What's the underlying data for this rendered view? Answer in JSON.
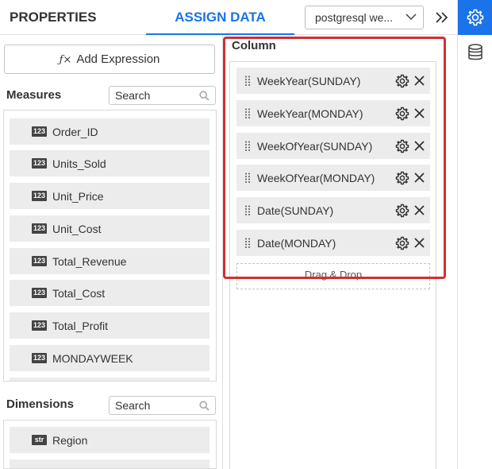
{
  "tabs": {
    "properties": "PROPERTIES",
    "assign_data": "ASSIGN DATA"
  },
  "datasource": {
    "selected": "postgresql we..."
  },
  "add_expression": {
    "symbol": "ƒ×",
    "label": "Add Expression"
  },
  "measures": {
    "title": "Measures",
    "search_placeholder": "Search",
    "items": [
      {
        "type": "123",
        "label": "Order_ID"
      },
      {
        "type": "123",
        "label": "Units_Sold"
      },
      {
        "type": "123",
        "label": "Unit_Price"
      },
      {
        "type": "123",
        "label": "Unit_Cost"
      },
      {
        "type": "123",
        "label": "Total_Revenue"
      },
      {
        "type": "123",
        "label": "Total_Cost"
      },
      {
        "type": "123",
        "label": "Total_Profit"
      },
      {
        "type": "123",
        "label": "MONDAYWEEK"
      }
    ]
  },
  "dimensions": {
    "title": "Dimensions",
    "search_placeholder": "Search",
    "items": [
      {
        "type": "str",
        "label": "Region"
      }
    ]
  },
  "column": {
    "title": "Column",
    "items": [
      {
        "label": "WeekYear(SUNDAY)"
      },
      {
        "label": "WeekYear(MONDAY)"
      },
      {
        "label": "WeekOfYear(SUNDAY)"
      },
      {
        "label": "WeekOfYear(MONDAY)"
      },
      {
        "label": "Date(SUNDAY)"
      },
      {
        "label": "Date(MONDAY)"
      }
    ],
    "drop_text": "Drag & Drop"
  },
  "icons": {
    "settings": "gear-icon",
    "datasource": "database-icon",
    "collapse": "double-chevron-right-icon",
    "dropdown": "chevron-down-icon",
    "search": "search-icon",
    "item_settings": "gear-icon",
    "item_remove": "close-icon",
    "drag": "drag-handle-icon"
  },
  "colors": {
    "accent": "#1a73e8",
    "highlight": "#d32f2f",
    "field_bg": "#ececec"
  }
}
